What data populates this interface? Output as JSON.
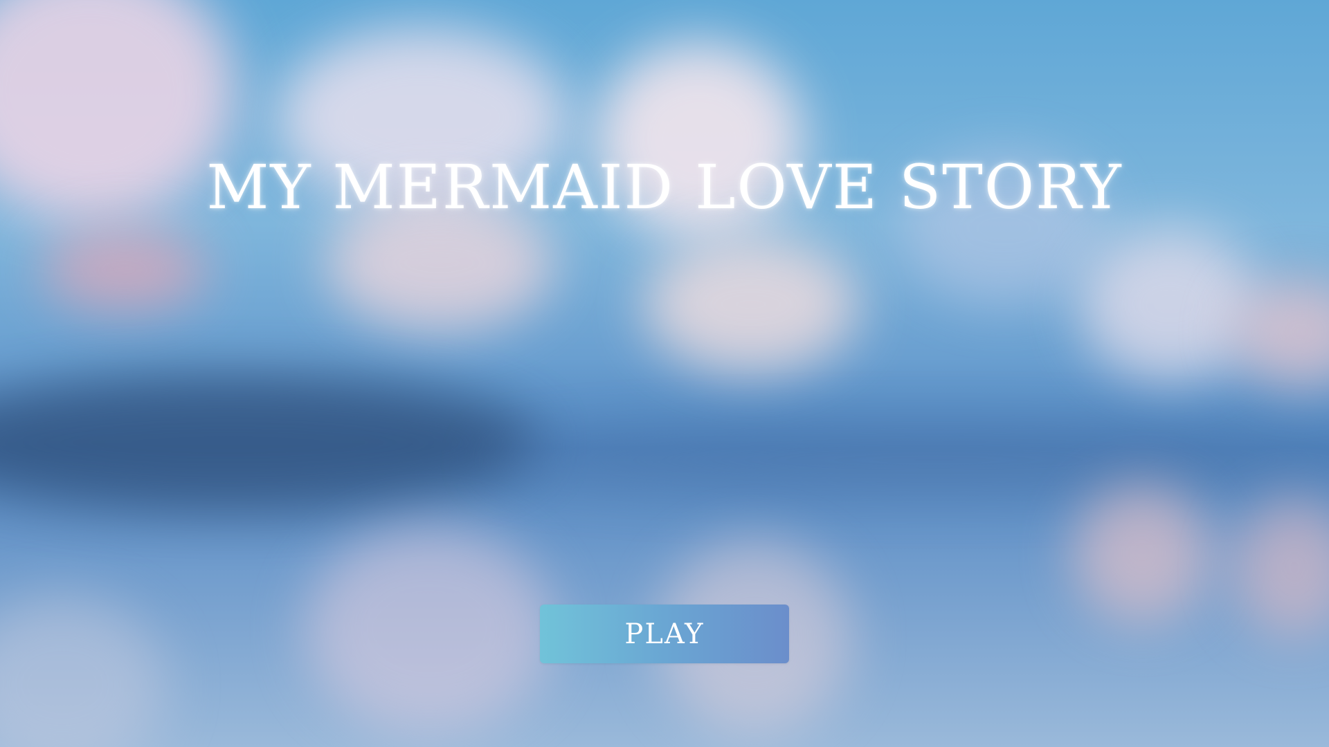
{
  "game": {
    "title": "MY MERMAID LOVE STORY",
    "play_label": "PLAY"
  },
  "colors": {
    "title_text": "#ffffff",
    "button_gradient_start": "#71c3d9",
    "button_gradient_end": "#6b8ecb"
  },
  "background": {
    "description_icon": "blurred-sky-sea-background"
  }
}
